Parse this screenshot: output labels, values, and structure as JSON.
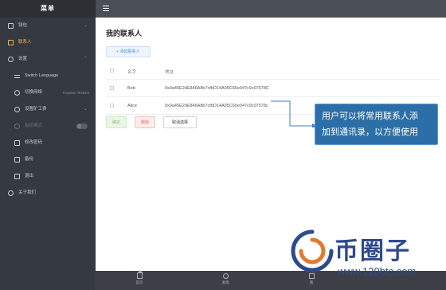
{
  "sidebar": {
    "title": "菜单",
    "items": [
      {
        "label": "钱包",
        "icon": "wallet-icon",
        "chevron": "⌄"
      },
      {
        "label": "联系人",
        "icon": "contacts-icon",
        "active": true
      },
      {
        "label": "设置",
        "icon": "settings-icon",
        "chevron": "⌃"
      },
      {
        "label": "Switch Language",
        "icon": "language-icon"
      },
      {
        "label": "切换网络",
        "icon": "network-icon",
        "note": "Ropsten TestNet"
      },
      {
        "label": "设置矿工费",
        "icon": "fee-icon",
        "chevron": "⌄"
      },
      {
        "label": "指纹模式",
        "icon": "fingerprint-icon",
        "disabled": true
      },
      {
        "label": "修改密码",
        "icon": "lock-icon"
      },
      {
        "label": "备份",
        "icon": "backup-icon"
      },
      {
        "label": "退出",
        "icon": "logout-icon"
      },
      {
        "label": "关于我们",
        "icon": "info-icon"
      }
    ]
  },
  "main": {
    "title": "我的联系人",
    "add_button": "+ 添加联系人",
    "table": {
      "headers": {
        "name": "名字",
        "address": "地址"
      },
      "rows": [
        {
          "name": "Bob",
          "address": "0x0a45E2dE846A8b7cfbD14A05C65e047c9c07578C"
        },
        {
          "name": "Alice",
          "address": "0x0a45E2dE846A8b7cfbD14A05C65e047c9c07578c"
        }
      ]
    },
    "actions": {
      "confirm": "确定",
      "delete": "删除",
      "cancel": "取消选择"
    }
  },
  "callout": {
    "line1": "用户可以将常用联系人添",
    "line2": "加到通讯录，以方便使用"
  },
  "tabbar": {
    "tabs": [
      {
        "label": "首页",
        "icon": "home-icon"
      },
      {
        "label": "发现",
        "icon": "compass-icon"
      },
      {
        "label": "我",
        "icon": "profile-icon"
      }
    ]
  },
  "watermark": {
    "text": "币圈子",
    "url": "www.120btc.com"
  },
  "colors": {
    "accent": "#f0b54a",
    "callout": "#2c6fa8",
    "sidebar": "#353a40"
  }
}
